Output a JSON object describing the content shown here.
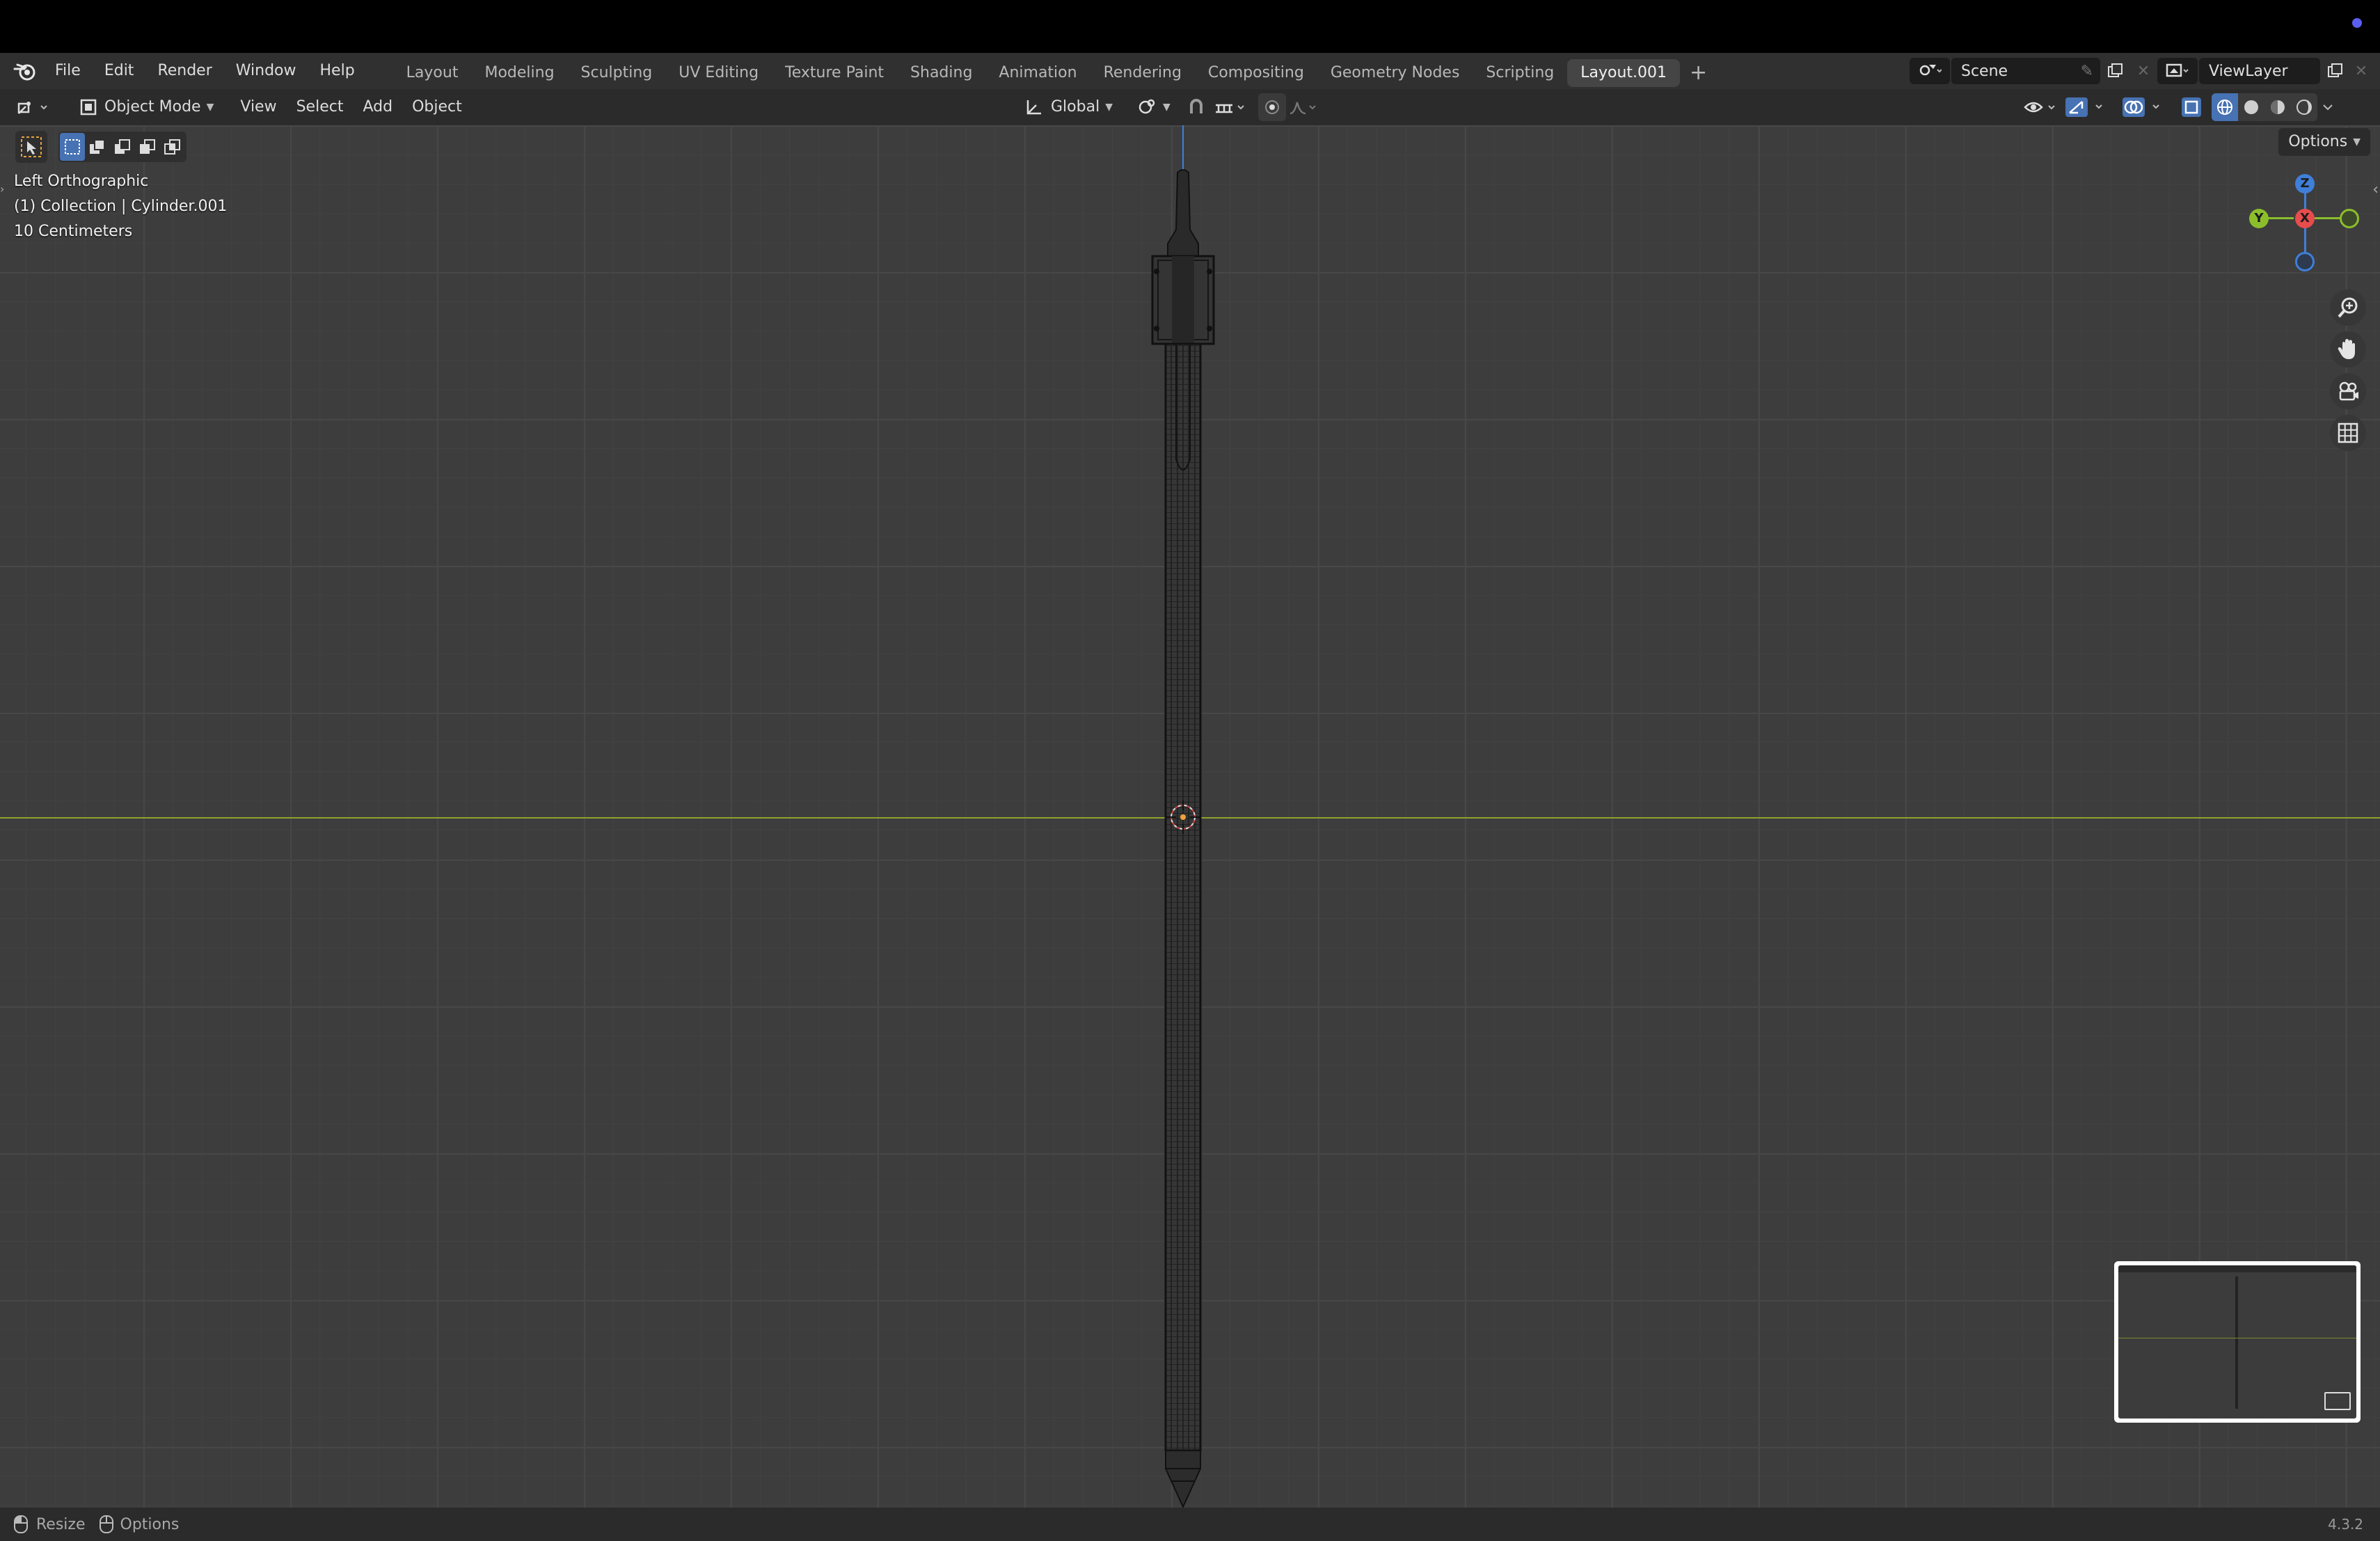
{
  "app": {
    "name": "Blender",
    "version": "4.3.2"
  },
  "menu": [
    "File",
    "Edit",
    "Render",
    "Window",
    "Help"
  ],
  "workspaces": [
    "Layout",
    "Modeling",
    "Sculpting",
    "UV Editing",
    "Texture Paint",
    "Shading",
    "Animation",
    "Rendering",
    "Compositing",
    "Geometry Nodes",
    "Scripting",
    "Layout.001"
  ],
  "active_workspace": "Layout.001",
  "scene": {
    "name": "Scene",
    "view_layer": "ViewLayer"
  },
  "header": {
    "mode": "Object Mode",
    "menus": [
      "View",
      "Select",
      "Add",
      "Object"
    ],
    "orientation": "Global",
    "options_label": "Options"
  },
  "viewport": {
    "view_name": "Left Orthographic",
    "collection_info": "(1) Collection | Cylinder.001",
    "scale_info": "10 Centimeters",
    "axis_labels": {
      "z": "Z",
      "y": "Y",
      "x": "X"
    },
    "axis_colors": {
      "x": "#e84c4c",
      "y": "#8cbe2c",
      "z": "#3f7fd8",
      "horizon": "#8ea32c"
    }
  },
  "statusbar": {
    "resize": "Resize",
    "options": "Options",
    "version": "4.3.2"
  },
  "icons": [
    "blender-logo",
    "editor-type-icon",
    "object-mode-icon",
    "transform-orientation-icon",
    "pivot-icon",
    "snap-icon",
    "proportional-edit-icon",
    "visibility-icon",
    "gizmo-icon",
    "overlay-icon",
    "xray-icon",
    "shading-wireframe",
    "shading-solid",
    "shading-material",
    "shading-rendered",
    "zoom-icon",
    "hand-icon",
    "camera-icon",
    "grid-icon",
    "pin-icon",
    "new-scene-icon",
    "close-icon"
  ]
}
